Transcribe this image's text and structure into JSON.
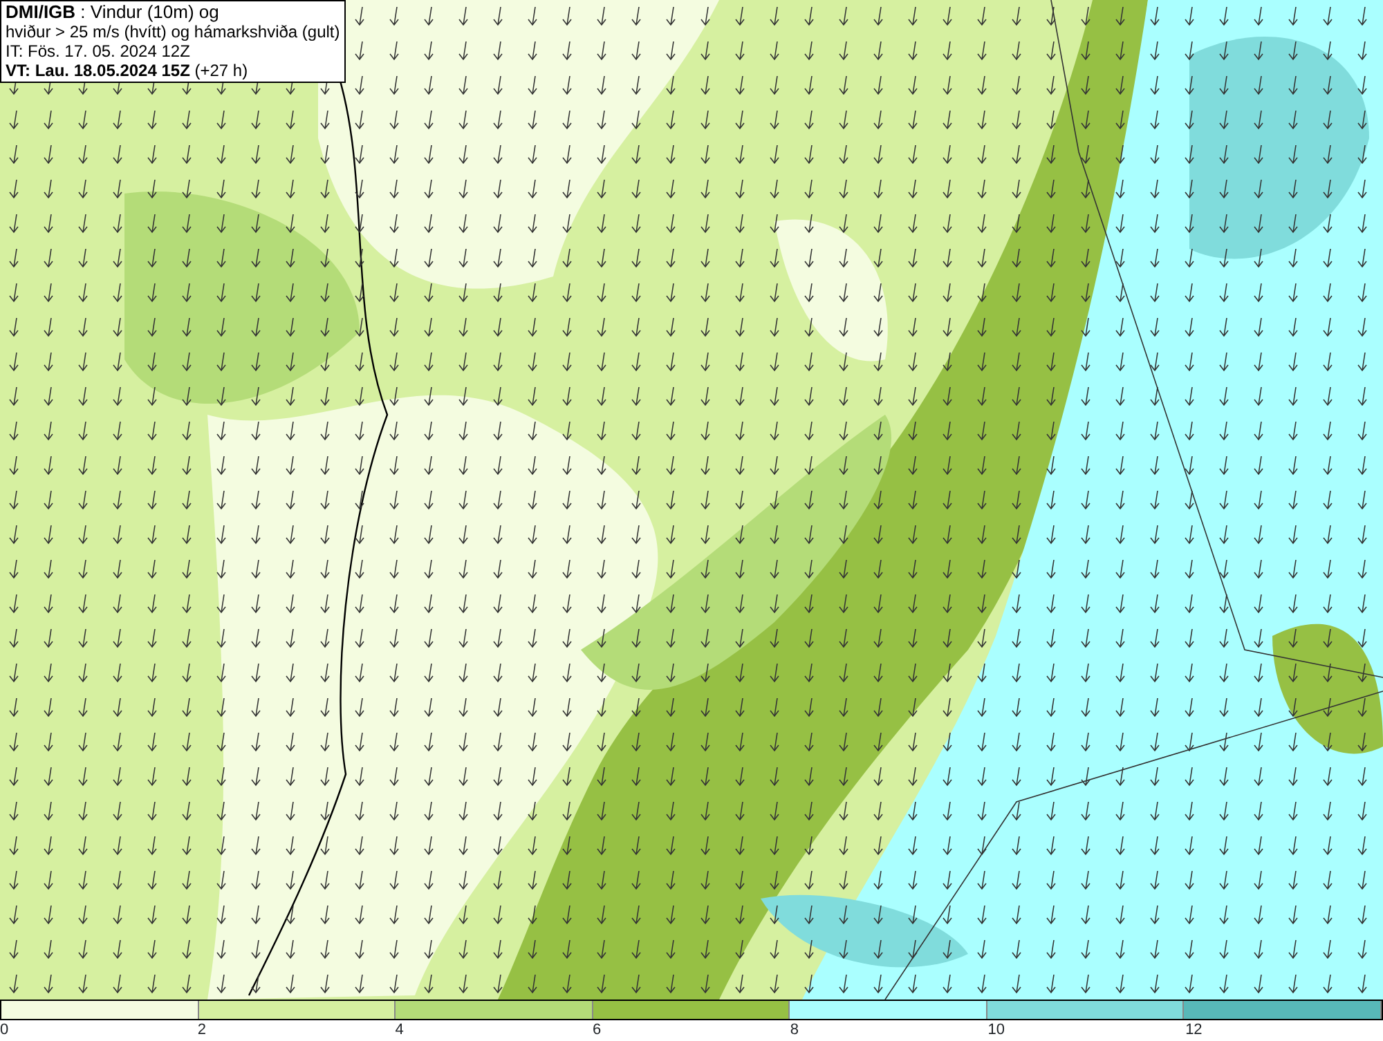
{
  "header": {
    "lines": [
      "**DMI/IGB** : Vindur (10m) og",
      "hviður > 25 m/s (hvítt) og hámarkshviða (gult)",
      "IT: Fös. 17. 05. 2024 12Z",
      "**VT: Lau. 18.05.2024 15Z** (+27 h)"
    ]
  },
  "legend": {
    "segments": [
      {
        "color": "#f4fce0"
      },
      {
        "color": "#d6f0a0"
      },
      {
        "color": "#b4dc78"
      },
      {
        "color": "#96c044"
      },
      {
        "color": "#aaffff"
      },
      {
        "color": "#80dcdc"
      },
      {
        "color": "#58b8b8"
      }
    ],
    "ticks": [
      "0",
      "2",
      "4",
      "6",
      "8",
      "10",
      "12"
    ]
  }
}
